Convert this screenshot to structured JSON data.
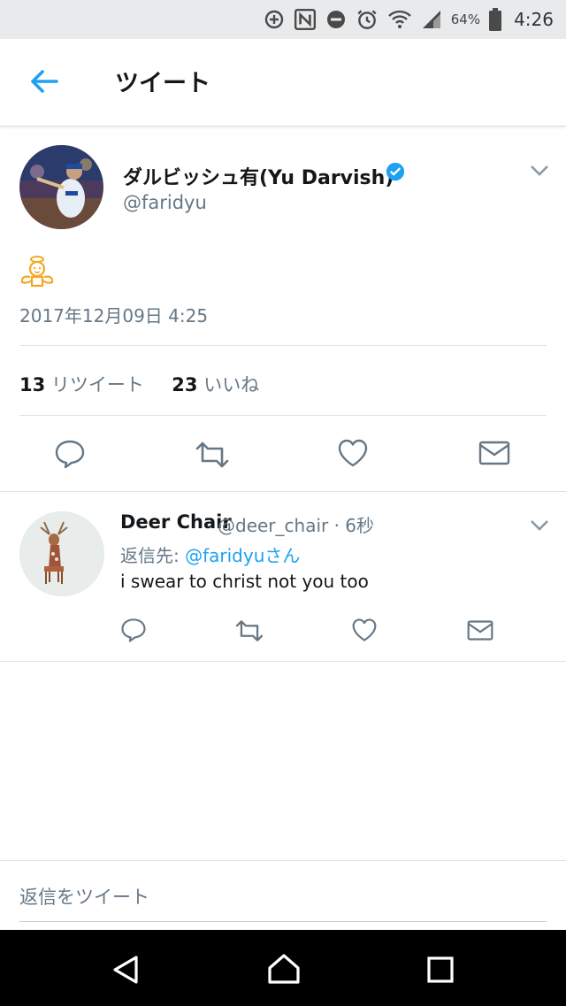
{
  "status_bar": {
    "battery_pct": "64%",
    "time": "4:26",
    "icons": [
      "data-saver-icon",
      "nfc-icon",
      "do-not-disturb-icon",
      "alarm-icon",
      "wifi-icon",
      "signal-icon",
      "battery-icon"
    ]
  },
  "header": {
    "title": "ツイート"
  },
  "tweet": {
    "author_name": "ダルビッシュ有(Yu Darvish)",
    "handle": "@faridyu",
    "date": "2017年12月09日 4:25",
    "retweet_count": "13",
    "retweet_label": "リツイート",
    "like_count": "23",
    "like_label": "いいね"
  },
  "reply": {
    "author_name": "Deer Chair",
    "handle_time": "@deer_chair · 6秒",
    "reply_to_prefix": "返信先: ",
    "reply_to_user": "@faridyuさん",
    "text": "i swear to christ not you too"
  },
  "composer": {
    "placeholder": "返信をツイート"
  },
  "colors": {
    "accent": "#1da1f2",
    "secondary_text": "#657786",
    "emoji_orange": "#f5a623"
  }
}
